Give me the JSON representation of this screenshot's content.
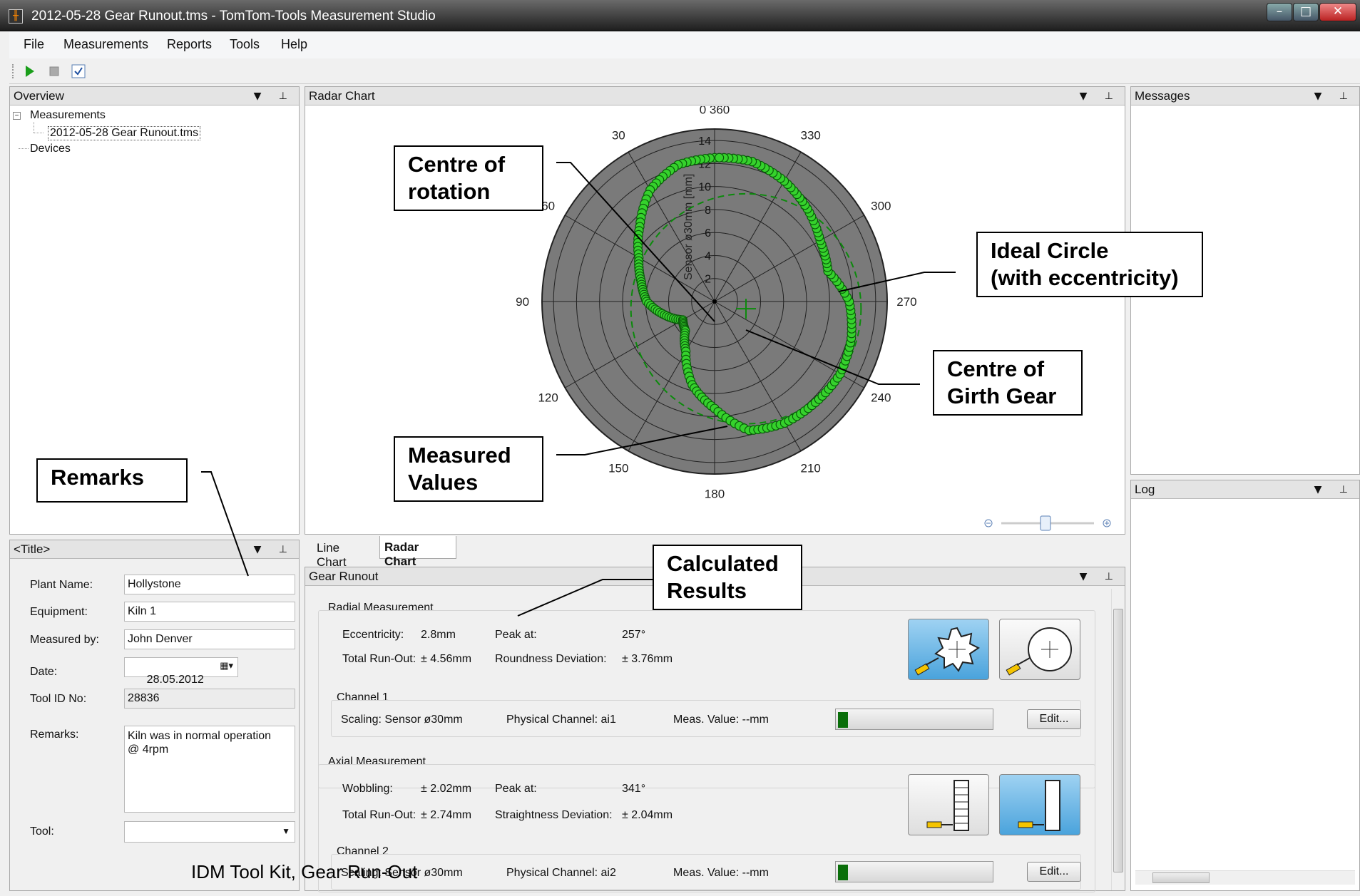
{
  "window": {
    "title": "2012-05-28 Gear Runout.tms - TomTom-Tools Measurement Studio",
    "icon": "app-logo-icon"
  },
  "menu": [
    "File",
    "Measurements",
    "Reports",
    "Tools",
    "Help"
  ],
  "toolbar": {
    "icons": [
      "play-icon",
      "stop-icon",
      "checkbox-icon"
    ]
  },
  "overview": {
    "title": "Overview",
    "tree": [
      "Measurements",
      "2012-05-28 Gear Runout.tms",
      "Devices"
    ]
  },
  "radar_panel": {
    "title": "Radar Chart"
  },
  "chart_tabs": [
    "Line Chart",
    "Radar Chart"
  ],
  "messages": {
    "title": "Messages"
  },
  "log": {
    "title": "Log"
  },
  "form": {
    "title": "<Title>",
    "fields": [
      {
        "label": "Plant Name:",
        "value": "Hollystone"
      },
      {
        "label": "Equipment:",
        "value": "Kiln 1"
      },
      {
        "label": "Measured by:",
        "value": "John Denver"
      },
      {
        "label": "Date:",
        "value": "28.05.2012"
      },
      {
        "label": "Tool ID No:",
        "value": "28836"
      },
      {
        "label": "Remarks:",
        "value": "Kiln was in normal operation\n@ 4rpm"
      },
      {
        "label": "Tool:",
        "value": ""
      }
    ]
  },
  "results": {
    "title": "Gear Runout",
    "radial": {
      "heading": "Radial Measurement",
      "eccentricity_label": "Eccentricity:",
      "eccentricity": "2.8mm",
      "peak_label": "Peak at:",
      "peak": "257°",
      "runout_label": "Total Run-Out:",
      "runout": "± 4.56mm",
      "deviation_label": "Roundness Deviation:",
      "deviation": "± 3.76mm",
      "channel": "Channel 1",
      "scaling": "Scaling: Sensor ø30mm",
      "physical": "Physical Channel: ai1",
      "meas": "Meas. Value: --mm",
      "edit": "Edit..."
    },
    "axial": {
      "heading": "Axial Measurement",
      "wobbling_label": "Wobbling:",
      "wobbling": "± 2.02mm",
      "peak_label": "Peak at:",
      "peak": "341°",
      "runout_label": "Total Run-Out:",
      "runout": "± 2.74mm",
      "deviation_label": "Straightness Deviation:",
      "deviation": "± 2.04mm",
      "channel": "Channel 2",
      "scaling": "Scaling: Sensor ø30mm",
      "physical": "Physical Channel: ai2",
      "meas": "Meas. Value: --mm",
      "edit": "Edit..."
    }
  },
  "callouts": {
    "centre_rotation": "Centre of\nrotation",
    "ideal_circle": "Ideal Circle\n(with eccentricity)",
    "centre_gear": "Centre of\nGirth Gear",
    "measured": "Measured\nValues",
    "remarks": "Remarks",
    "calculated": "Calculated\nResults"
  },
  "footer_caption": "IDM Tool Kit, Gear Run-Out",
  "chart_data": {
    "type": "radar",
    "angle_labels": [
      "0 360",
      "330",
      "300",
      "270",
      "240",
      "210",
      "180",
      "150",
      "120",
      "90",
      "60",
      "30"
    ],
    "radial_ticks": [
      "2",
      "4",
      "6",
      "8",
      "10",
      "12",
      "14"
    ],
    "radial_axis_label": "Sensor ø30mm [mm]",
    "rmax": 15,
    "gear_center_offset": {
      "angle_deg": 257,
      "r": 2.8
    },
    "measured_series": [
      {
        "angle": 0,
        "r": 12.5
      },
      {
        "angle": 15,
        "r": 12.3
      },
      {
        "angle": 30,
        "r": 11.2
      },
      {
        "angle": 45,
        "r": 9.2
      },
      {
        "angle": 60,
        "r": 7.6
      },
      {
        "angle": 75,
        "r": 6.6
      },
      {
        "angle": 90,
        "r": 5.9
      },
      {
        "angle": 105,
        "r": 4.5
      },
      {
        "angle": 120,
        "r": 3.2
      },
      {
        "angle": 135,
        "r": 3.6
      },
      {
        "angle": 150,
        "r": 5.0
      },
      {
        "angle": 165,
        "r": 7.5
      },
      {
        "angle": 180,
        "r": 9.3
      },
      {
        "angle": 195,
        "r": 11.6
      },
      {
        "angle": 210,
        "r": 12.2
      },
      {
        "angle": 225,
        "r": 12.4
      },
      {
        "angle": 240,
        "r": 12.6
      },
      {
        "angle": 255,
        "r": 12.3
      },
      {
        "angle": 270,
        "r": 11.7
      },
      {
        "angle": 285,
        "r": 10.2
      },
      {
        "angle": 300,
        "r": 10.6
      },
      {
        "angle": 315,
        "r": 11.4
      },
      {
        "angle": 330,
        "r": 12.1
      },
      {
        "angle": 345,
        "r": 12.6
      }
    ]
  }
}
